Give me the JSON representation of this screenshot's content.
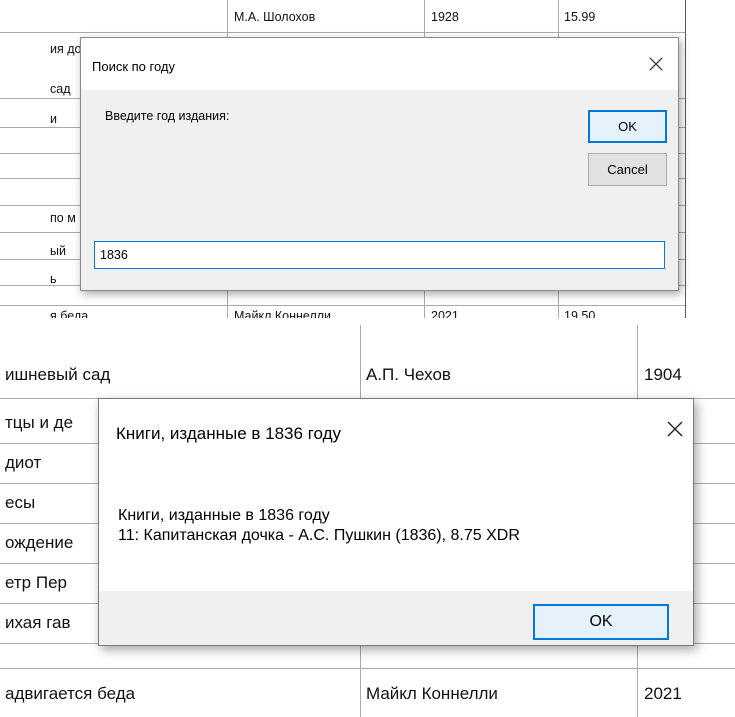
{
  "top_table": {
    "rows": [
      {
        "title": "",
        "author": "М.А. Шолохов",
        "year": "1928",
        "price": "15.99"
      },
      {
        "title": "ия до",
        "author": "",
        "year": "",
        "price": ""
      },
      {
        "title": "сад",
        "author": "",
        "year": "",
        "price": ""
      },
      {
        "title": "и",
        "author": "",
        "year": "",
        "price": ""
      },
      {
        "title": "по м",
        "author": "",
        "year": "",
        "price": ""
      },
      {
        "title": "ый",
        "author": "",
        "year": "",
        "price": ""
      },
      {
        "title": "ь",
        "author": "",
        "year": "",
        "price": ""
      },
      {
        "title": "я беда",
        "author": "Майкл Коннелли",
        "year": "2021",
        "price": "19.50"
      }
    ]
  },
  "search_dialog": {
    "title": "Поиск по году",
    "prompt": "Введите год издания:",
    "ok_label": "OK",
    "cancel_label": "Cancel",
    "input_value": "1836"
  },
  "bottom_table": {
    "rows": [
      {
        "title": "ишневый сад",
        "author": "А.П. Чехов",
        "year": "1904"
      },
      {
        "title": "тцы и де",
        "author": "",
        "year": ""
      },
      {
        "title": "диот",
        "author": "",
        "year": ""
      },
      {
        "title": "есы",
        "author": "",
        "year": ""
      },
      {
        "title": "ождение",
        "author": "",
        "year": ""
      },
      {
        "title": "етр Пер",
        "author": "",
        "year": ""
      },
      {
        "title": "ихая гав",
        "author": "",
        "year": ""
      },
      {
        "title": "адвигается беда",
        "author": "Майкл Коннелли",
        "year": "2021"
      }
    ]
  },
  "result_dialog": {
    "title": "Книги, изданные в 1836 году",
    "message_heading": "Книги, изданные в 1836 году",
    "message_result": "11: Капитанская дочка - А.С. Пушкин (1836), 8.75 XDR",
    "ok_label": "OK"
  },
  "colors": {
    "accent": "#0078d7",
    "dialog_body": "#f0f0f0",
    "grid_line": "#aaaaaa"
  },
  "icons": [
    "close-icon",
    "close-icon"
  ]
}
